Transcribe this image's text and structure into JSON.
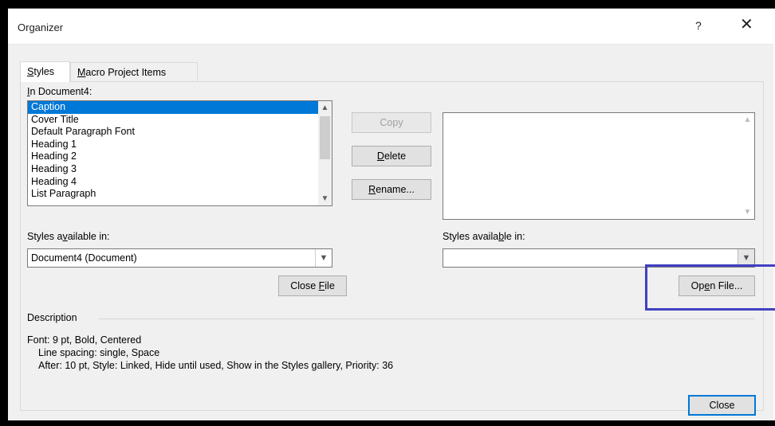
{
  "window": {
    "title": "Organizer",
    "help": "?",
    "close_glyph": "✕"
  },
  "tabs": [
    {
      "pre": "",
      "key": "S",
      "post": "tyles"
    },
    {
      "pre": "",
      "key": "M",
      "post": "acro Project Items"
    }
  ],
  "left": {
    "label_pre": "",
    "label_key": "I",
    "label_post": "n Document4:",
    "items": [
      "Caption",
      "Cover Title",
      "Default Paragraph Font",
      "Heading 1",
      "Heading 2",
      "Heading 3",
      "Heading 4",
      "List Paragraph"
    ],
    "selected_index": 0,
    "avail_pre": "Styles a",
    "avail_key": "v",
    "avail_post": "ailable in:",
    "combo_value": "Document4 (Document)",
    "close_file_pre": "Close ",
    "close_file_key": "F",
    "close_file_post": "ile"
  },
  "middle": {
    "copy": "Copy",
    "delete_pre": "",
    "delete_key": "D",
    "delete_post": "elete",
    "rename_pre": "",
    "rename_key": "R",
    "rename_post": "ename..."
  },
  "right": {
    "avail_pre": "Styles availa",
    "avail_key": "b",
    "avail_post": "le in:",
    "combo_value": "",
    "open_file_pre": "Op",
    "open_file_key": "e",
    "open_file_post": "n File..."
  },
  "description": {
    "heading": "Description",
    "line1": "Font: 9 pt, Bold, Centered",
    "line2": "Line spacing:  single, Space",
    "line3": "After:  10 pt, Style: Linked, Hide until used, Show in the Styles gallery, Priority: 36"
  },
  "footer": {
    "close": "Close"
  },
  "colors": {
    "selection": "#0078d7",
    "highlight_box": "#4040c0"
  }
}
